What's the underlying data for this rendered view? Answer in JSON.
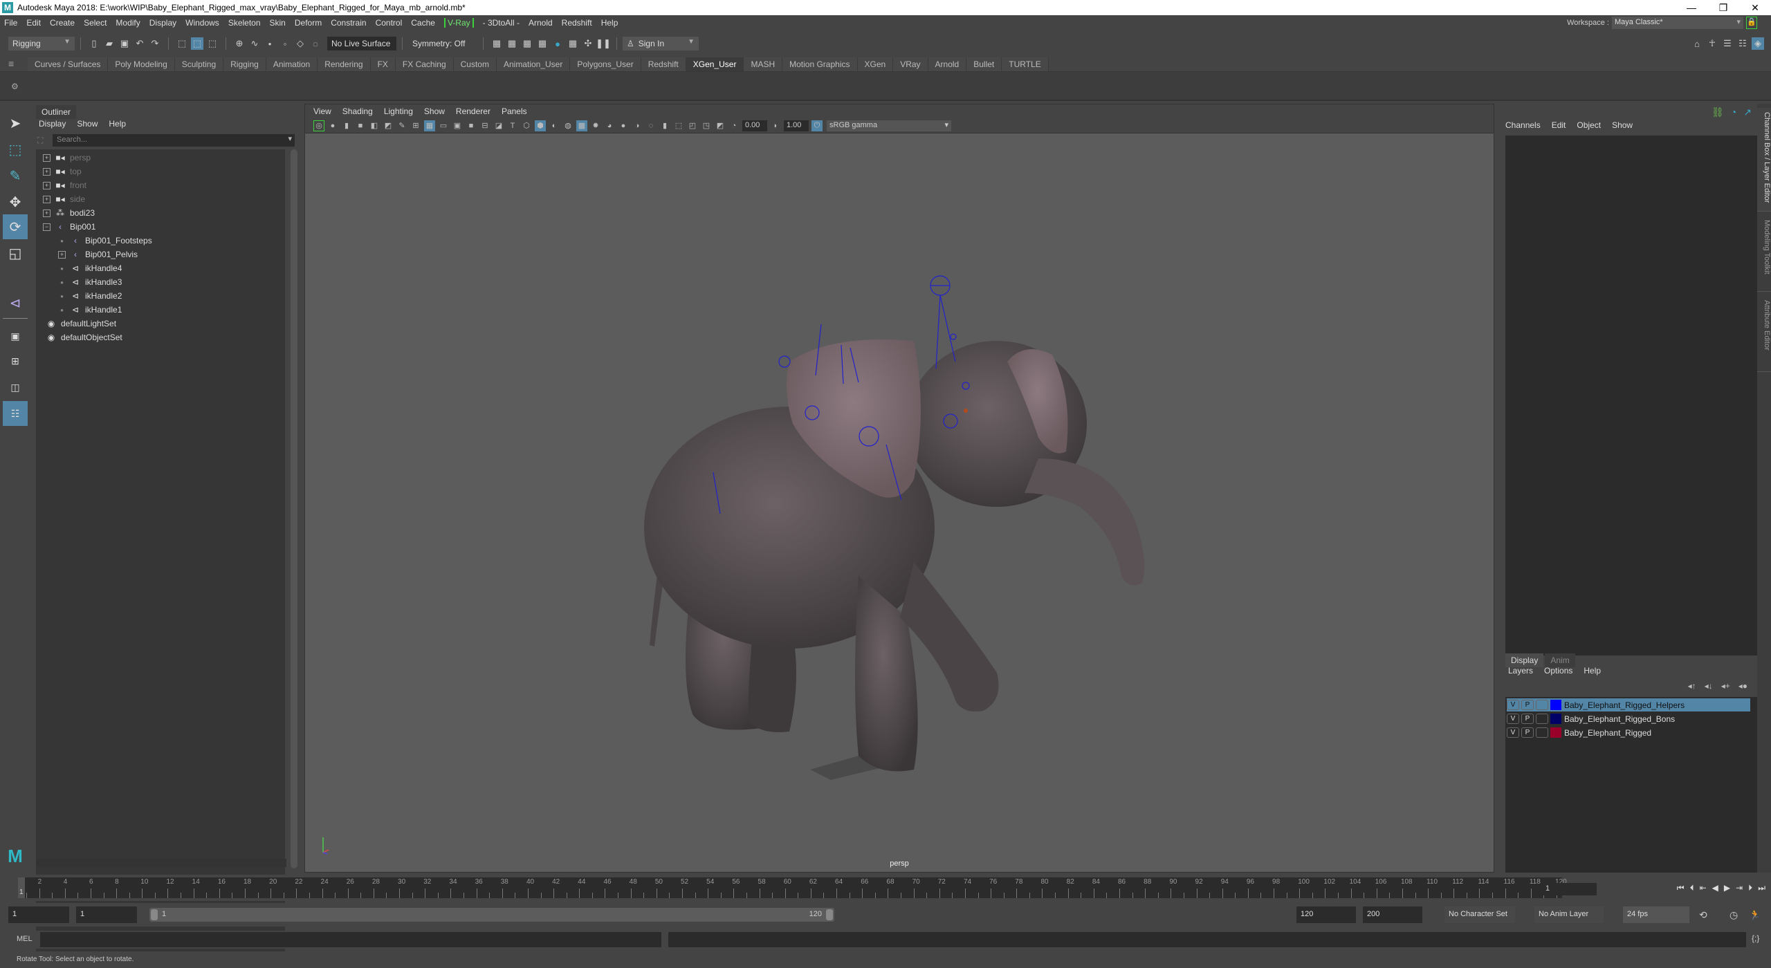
{
  "window": {
    "title": "Autodesk Maya 2018: E:\\work\\WIP\\Baby_Elephant_Rigged_max_vray\\Baby_Elephant_Rigged_for_Maya_mb_arnold.mb*",
    "logo": "M",
    "minimize": "—",
    "maximize": "❐",
    "close": "✕"
  },
  "menubar": [
    "File",
    "Edit",
    "Create",
    "Select",
    "Modify",
    "Display",
    "Windows",
    "Skeleton",
    "Skin",
    "Deform",
    "Constrain",
    "Control",
    "Cache",
    "V-Ray",
    "- 3DtoAll -",
    "Arnold",
    "Redshift",
    "Help"
  ],
  "workspace": {
    "label": "Workspace :",
    "value": "Maya Classic*",
    "lock_icon": "🔒"
  },
  "statusline": {
    "menuset": "Rigging",
    "live_surface": "No Live Surface",
    "symmetry": "Symmetry: Off",
    "sign_in": "Sign In"
  },
  "shelf_tabs": [
    "Curves / Surfaces",
    "Poly Modeling",
    "Sculpting",
    "Rigging",
    "Animation",
    "Rendering",
    "FX",
    "FX Caching",
    "Custom",
    "Animation_User",
    "Polygons_User",
    "Redshift",
    "XGen_User",
    "MASH",
    "Motion Graphics",
    "XGen",
    "VRay",
    "Arnold",
    "Bullet",
    "TURTLE"
  ],
  "active_shelf_tab": "XGen_User",
  "toolbox": [
    {
      "name": "select-tool",
      "glyph": "➤",
      "active": false
    },
    {
      "name": "lasso-tool",
      "glyph": "⬚",
      "active": false
    },
    {
      "name": "paint-select-tool",
      "glyph": "✎",
      "active": false
    },
    {
      "name": "move-tool",
      "glyph": "✥",
      "active": false
    },
    {
      "name": "rotate-tool",
      "glyph": "⟳",
      "active": true
    },
    {
      "name": "scale-tool",
      "glyph": "◱",
      "active": false
    },
    {
      "name": "ik-handle-tool",
      "glyph": "⊲",
      "active": false
    }
  ],
  "outliner": {
    "title": "Outliner",
    "menu": [
      "Display",
      "Show",
      "Help"
    ],
    "search_placeholder": "Search...",
    "items": [
      {
        "label": "persp",
        "icon": "camera-icon",
        "glyph": "■◂",
        "expand": "+",
        "indent": 0,
        "dim": true
      },
      {
        "label": "top",
        "icon": "camera-icon",
        "glyph": "■◂",
        "expand": "+",
        "indent": 0,
        "dim": true
      },
      {
        "label": "front",
        "icon": "camera-icon",
        "glyph": "■◂",
        "expand": "+",
        "indent": 0,
        "dim": true
      },
      {
        "label": "side",
        "icon": "camera-icon",
        "glyph": "■◂",
        "expand": "+",
        "indent": 0,
        "dim": true
      },
      {
        "label": "bodi23",
        "icon": "mesh-group-icon",
        "glyph": "⁂",
        "expand": "+",
        "indent": 0,
        "dim": false
      },
      {
        "label": "Bip001",
        "icon": "joint-icon",
        "glyph": "‹",
        "expand": "−",
        "indent": 0,
        "dim": false
      },
      {
        "label": "Bip001_Footsteps",
        "icon": "joint-icon",
        "glyph": "‹",
        "expand": "",
        "indent": 1,
        "dim": false
      },
      {
        "label": "Bip001_Pelvis",
        "icon": "joint-icon",
        "glyph": "‹",
        "expand": "+",
        "indent": 1,
        "dim": false
      },
      {
        "label": "ikHandle4",
        "icon": "ik-handle-icon",
        "glyph": "⊲",
        "expand": "",
        "indent": 1,
        "dim": false
      },
      {
        "label": "ikHandle3",
        "icon": "ik-handle-icon",
        "glyph": "⊲",
        "expand": "",
        "indent": 1,
        "dim": false
      },
      {
        "label": "ikHandle2",
        "icon": "ik-handle-icon",
        "glyph": "⊲",
        "expand": "",
        "indent": 1,
        "dim": false
      },
      {
        "label": "ikHandle1",
        "icon": "ik-handle-icon",
        "glyph": "⊲",
        "expand": "",
        "indent": 1,
        "dim": false
      },
      {
        "label": "defaultLightSet",
        "icon": "set-icon",
        "glyph": "◉",
        "expand": "",
        "indent": 0,
        "dim": false
      },
      {
        "label": "defaultObjectSet",
        "icon": "set-icon",
        "glyph": "◉",
        "expand": "",
        "indent": 0,
        "dim": false
      }
    ]
  },
  "viewport": {
    "menu": [
      "View",
      "Shading",
      "Lighting",
      "Show",
      "Renderer",
      "Panels"
    ],
    "exposure": "0.00",
    "gamma": "1.00",
    "color_space": "sRGB gamma",
    "camera": "persp",
    "background_color": "#5c5c5c"
  },
  "channelbox": {
    "menu": [
      "Channels",
      "Edit",
      "Object",
      "Show"
    ]
  },
  "layer_editor": {
    "tabs": [
      "Display",
      "Anim"
    ],
    "active_tab": "Display",
    "menu": [
      "Layers",
      "Options",
      "Help"
    ],
    "layers": [
      {
        "v": "V",
        "p": "P",
        "name": "Baby_Elephant_Rigged_Helpers",
        "color": "#0000ff",
        "selected": true
      },
      {
        "v": "V",
        "p": "P",
        "name": "Baby_Elephant_Rigged_Bons",
        "color": "#000066",
        "selected": false
      },
      {
        "v": "V",
        "p": "P",
        "name": "Baby_Elephant_Rigged",
        "color": "#99002a",
        "selected": false
      }
    ]
  },
  "side_tabs": [
    "Channel Box / Layer Editor",
    "Modeling Toolkit",
    "Attribute Editor"
  ],
  "timeline": {
    "start": 1,
    "end": 120,
    "current_frame": "1",
    "tick_labels": [
      2,
      4,
      6,
      8,
      10,
      12,
      14,
      16,
      18,
      20,
      22,
      24,
      26,
      28,
      30,
      32,
      34,
      36,
      38,
      40,
      42,
      44,
      46,
      48,
      50,
      52,
      54,
      56,
      58,
      60,
      62,
      64,
      66,
      68,
      70,
      72,
      74,
      76,
      78,
      80,
      82,
      84,
      86,
      88,
      90,
      92,
      94,
      96,
      98,
      100,
      102,
      104,
      106,
      108,
      110,
      112,
      114,
      116,
      118,
      120
    ]
  },
  "range": {
    "start_field": "1",
    "playback_start": "1",
    "slider_start": "1",
    "slider_end": "120",
    "playback_end": "120",
    "end_field": "200",
    "character_set": "No Character Set",
    "anim_layer": "No Anim Layer",
    "fps": "24 fps"
  },
  "command_line": {
    "label": "MEL",
    "value": ""
  },
  "status": {
    "help_text": "Rotate Tool: Select an object to rotate."
  }
}
